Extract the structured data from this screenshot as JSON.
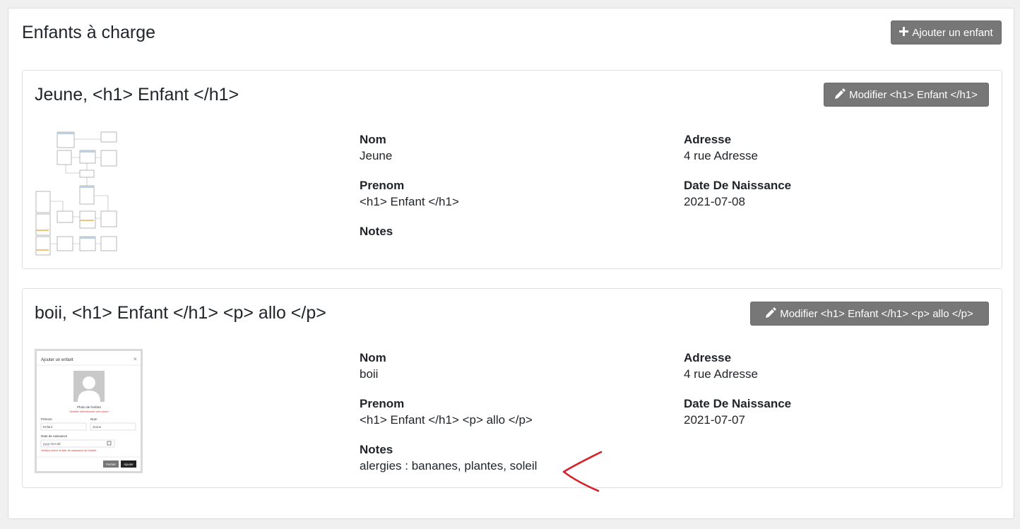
{
  "page": {
    "title": "Enfants à charge",
    "add_button": "Ajouter un enfant"
  },
  "children": [
    {
      "title": "Jeune, <h1> Enfant </h1>",
      "edit_button": "Modifier <h1> Enfant </h1>",
      "fields": {
        "nom_label": "Nom",
        "nom": "Jeune",
        "prenom_label": "Prenom",
        "prenom": "<h1> Enfant </h1>",
        "notes_label": "Notes",
        "notes": "",
        "adresse_label": "Adresse",
        "adresse": "4 rue Adresse",
        "naissance_label": "Date De Naissance",
        "naissance": "2021-07-08"
      }
    },
    {
      "title": "boii, <h1> Enfant </h1> <p> allo </p>",
      "edit_button": "Modifier <h1> Enfant </h1> <p> allo </p>",
      "fields": {
        "nom_label": "Nom",
        "nom": "boii",
        "prenom_label": "Prenom",
        "prenom": "<h1> Enfant </h1> <p> allo </p>",
        "notes_label": "Notes",
        "notes": "alergies : bananes, plantes, soleil",
        "adresse_label": "Adresse",
        "adresse": "4 rue Adresse",
        "naissance_label": "Date De Naissance",
        "naissance": "2021-07-07"
      },
      "photo": {
        "header": "Ajouter un enfant",
        "close": "×",
        "caption": "Photo de l'enfant",
        "error1": "Veuillez sélectionner une photo",
        "prenom_label": "Prénom",
        "prenom_value": "Enfant",
        "nom_label": "Nom",
        "nom_value": "Jeune",
        "date_label": "Date de naissance",
        "date_placeholder": "yyyy-mm-dd",
        "error2": "Veuillez entrer la date de naissance de l'enfant",
        "close_btn": "Fermer",
        "add_btn": "Ajouter"
      }
    }
  ],
  "colors": {
    "button_bg": "#777777",
    "annotation": "#d6202a"
  },
  "icons": {
    "add": "plus-icon",
    "edit": "pencil-icon"
  }
}
